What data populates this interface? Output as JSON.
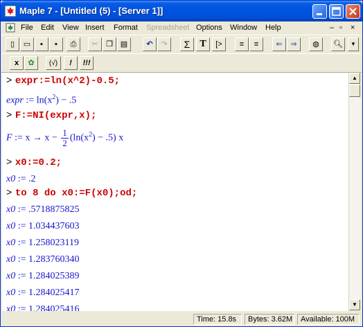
{
  "window": {
    "title": "Maple 7 - [Untitled (5) - [Server 1]]"
  },
  "menu": [
    "File",
    "Edit",
    "View",
    "Insert",
    "Format",
    "Spreadsheet",
    "Options",
    "Window",
    "Help"
  ],
  "menu_disabled": [
    "Spreadsheet"
  ],
  "toolbar_row2": {
    "x_btn": "x",
    "stop_btn": "!",
    "exec_all_btn": "!!!",
    "paren_btn": "(√)"
  },
  "worksheet": {
    "prompt": ">",
    "cmd1": "expr:=ln(x^2)-0.5;",
    "out1": {
      "lhs": "expr",
      "assign": ":=",
      "rhs_a": "ln(x",
      "exp": "2",
      "rhs_b": ") − .5"
    },
    "cmd2": "F:=NI(expr,x);",
    "out2": {
      "lhs": "F",
      "assign": ":=",
      "a": "x → x −",
      "num": "1",
      "den": "2",
      "b": "(ln(x",
      "exp": "2",
      "c": ") − .5) x"
    },
    "cmd3": "x0:=0.2;",
    "out3": {
      "lhs": "x0",
      "assign": ":=",
      "rhs": ".2"
    },
    "cmd4": "to 8 do x0:=F(x0);od;",
    "iterates": [
      ".5718875825",
      "1.034437603",
      "1.258023119",
      "1.283760340",
      "1.284025389",
      "1.284025417",
      "1.284025416"
    ]
  },
  "status": {
    "time": "Time: 15.8s",
    "bytes": "Bytes: 3.62M",
    "available": "Available: 100M"
  }
}
